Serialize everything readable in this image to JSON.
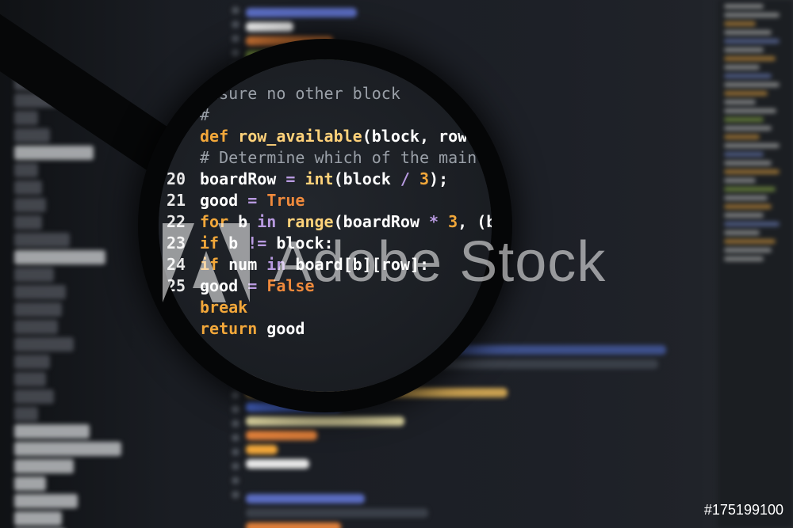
{
  "lens_code": {
    "lines": [
      {
        "num": "",
        "tokens": [
          {
            "t": "ensure no other block",
            "c": "comment"
          }
        ]
      },
      {
        "num": "",
        "tokens": [
          {
            "t": "#",
            "c": "comment"
          }
        ]
      },
      {
        "num": "",
        "tokens": [
          {
            "t": "def ",
            "c": "kw-orange"
          },
          {
            "t": "row_available",
            "c": "func"
          },
          {
            "t": "(block, row",
            "c": "ident"
          }
        ]
      },
      {
        "num": "",
        "tokens": [
          {
            "t": "# Determine which of the main",
            "c": "comment"
          }
        ]
      },
      {
        "num": "20",
        "tokens": [
          {
            "t": "boardRow ",
            "c": "ident"
          },
          {
            "t": "= ",
            "c": "kw-purple"
          },
          {
            "t": "int",
            "c": "func"
          },
          {
            "t": "(block ",
            "c": "ident"
          },
          {
            "t": "/ ",
            "c": "kw-purple"
          },
          {
            "t": "3",
            "c": "num"
          },
          {
            "t": ");",
            "c": "ident"
          }
        ]
      },
      {
        "num": "21",
        "tokens": [
          {
            "t": "good ",
            "c": "ident"
          },
          {
            "t": "= ",
            "c": "kw-purple"
          },
          {
            "t": "True",
            "c": "str-orange"
          }
        ]
      },
      {
        "num": "22",
        "tokens": [
          {
            "t": "for ",
            "c": "kw-orange"
          },
          {
            "t": "b ",
            "c": "ident"
          },
          {
            "t": "in ",
            "c": "kw-purple"
          },
          {
            "t": "range",
            "c": "func"
          },
          {
            "t": "(boardRow ",
            "c": "ident"
          },
          {
            "t": "* ",
            "c": "kw-purple"
          },
          {
            "t": "3",
            "c": "num"
          },
          {
            "t": ", (b",
            "c": "ident"
          }
        ]
      },
      {
        "num": "23",
        "tokens": [
          {
            "t": "if ",
            "c": "kw-orange"
          },
          {
            "t": "b ",
            "c": "ident"
          },
          {
            "t": "!= ",
            "c": "kw-purple"
          },
          {
            "t": "block:",
            "c": "ident"
          }
        ]
      },
      {
        "num": "24",
        "tokens": [
          {
            "t": "if ",
            "c": "kw-orange"
          },
          {
            "t": "num ",
            "c": "ident"
          },
          {
            "t": "in ",
            "c": "kw-purple"
          },
          {
            "t": "board[b][row]:",
            "c": "ident"
          }
        ]
      },
      {
        "num": "25",
        "tokens": [
          {
            "t": "good ",
            "c": "ident"
          },
          {
            "t": "= ",
            "c": "kw-purple"
          },
          {
            "t": "False",
            "c": "str-orange"
          }
        ]
      },
      {
        "num": "",
        "tokens": [
          {
            "t": "break",
            "c": "kw-orange"
          }
        ]
      },
      {
        "num": "",
        "tokens": [
          {
            "t": "return ",
            "c": "kw-orange"
          },
          {
            "t": "good",
            "c": "ident"
          }
        ]
      }
    ]
  },
  "watermark": {
    "text": "Adobe Stock"
  },
  "stock_id": "#175199100",
  "colors": {
    "background": "#15171c",
    "keyword": "#f2a73a",
    "operator": "#b89ae0",
    "literal": "#f08a3c"
  }
}
